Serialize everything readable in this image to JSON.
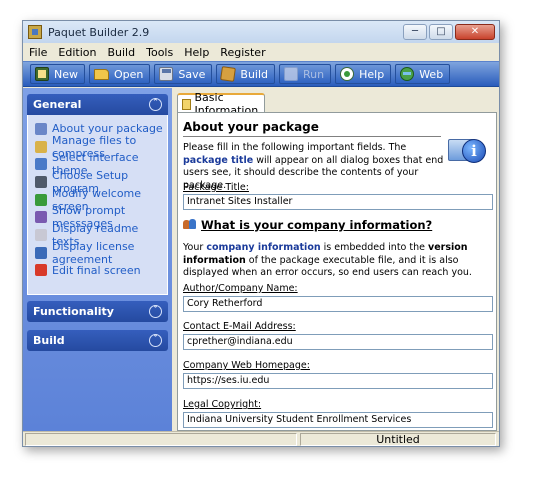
{
  "window": {
    "title": "Paquet Builder 2.9"
  },
  "menu": [
    {
      "label": "File"
    },
    {
      "label": "Edition"
    },
    {
      "label": "Build"
    },
    {
      "label": "Tools"
    },
    {
      "label": "Help"
    },
    {
      "label": "Register"
    }
  ],
  "toolbar": {
    "new": "New",
    "open": "Open",
    "save": "Save",
    "build": "Build",
    "run": "Run",
    "help": "Help",
    "web": "Web"
  },
  "sidebar": {
    "general": {
      "title": "General",
      "items": [
        {
          "label": "About your package",
          "color": "#6a86c8"
        },
        {
          "label": "Manage files to compress",
          "color": "#d9b24a"
        },
        {
          "label": "Select interface theme",
          "color": "#4a7ac8"
        },
        {
          "label": "Choose Setup program",
          "color": "#505a6a"
        },
        {
          "label": "Modify welcome screen",
          "color": "#3a9a3a"
        },
        {
          "label": "Show prompt messsages",
          "color": "#7a5ab0"
        },
        {
          "label": "Display readme texts",
          "color": "#c8c8d4"
        },
        {
          "label": "Display license agreement",
          "color": "#3a6ab8"
        },
        {
          "label": "Edit final screen",
          "color": "#d83a2a"
        }
      ]
    },
    "functionality": {
      "title": "Functionality"
    },
    "build": {
      "title": "Build"
    }
  },
  "tab": {
    "label": "Basic Information"
  },
  "content": {
    "about_title": "About your package",
    "about_p1": "Please fill in the following important fields. The ",
    "about_hl": "package title",
    "about_p2": " will appear on all dialog boxes that end users see, it should describe the contents of your package.",
    "package_title_label": "Package Title:",
    "package_title_value": "Intranet Sites Installer",
    "company_title": "What is your company information?",
    "company_p1": "Your ",
    "company_hl": "company information",
    "company_p2": " is embedded into the ",
    "company_blk": "version information",
    "company_p3": " of the package executable file, and it is also displayed when an error occurs, so end users can reach you.",
    "author_label": "Author/Company Name:",
    "author_value": "Cory Retherford",
    "email_label": "Contact E-Mail Address:",
    "email_value": "cprether@indiana.edu",
    "homepage_label": "Company Web Homepage:",
    "homepage_value": "https://ses.iu.edu",
    "copyright_label": "Legal Copyright:",
    "copyright_value": "Indiana University Student Enrollment Services"
  },
  "status": {
    "file": "Untitled"
  }
}
